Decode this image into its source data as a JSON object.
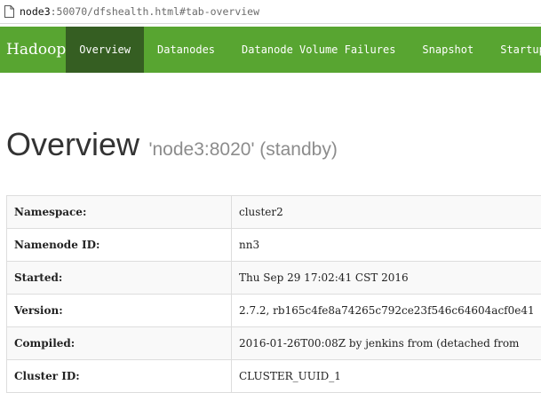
{
  "browser": {
    "url_host": "node3",
    "url_rest": ":50070/dfshealth.html#tab-overview"
  },
  "navbar": {
    "brand": "Hadoop",
    "tabs": [
      "Overview",
      "Datanodes",
      "Datanode Volume Failures",
      "Snapshot",
      "Startup"
    ],
    "active_tab": "Overview",
    "color": "#58a531",
    "active_color": "#355e22"
  },
  "page": {
    "title": "Overview",
    "subtitle": "'node3:8020' (standby)"
  },
  "overview_table": [
    {
      "key": "Namespace:",
      "value": "cluster2"
    },
    {
      "key": "Namenode ID:",
      "value": "nn3"
    },
    {
      "key": "Started:",
      "value": "Thu Sep 29 17:02:41 CST 2016"
    },
    {
      "key": "Version:",
      "value": "2.7.2, rb165c4fe8a74265c792ce23f546c64604acf0e41"
    },
    {
      "key": "Compiled:",
      "value": "2016-01-26T00:08Z by jenkins from (detached from"
    },
    {
      "key": "Cluster ID:",
      "value": "CLUSTER_UUID_1"
    }
  ]
}
